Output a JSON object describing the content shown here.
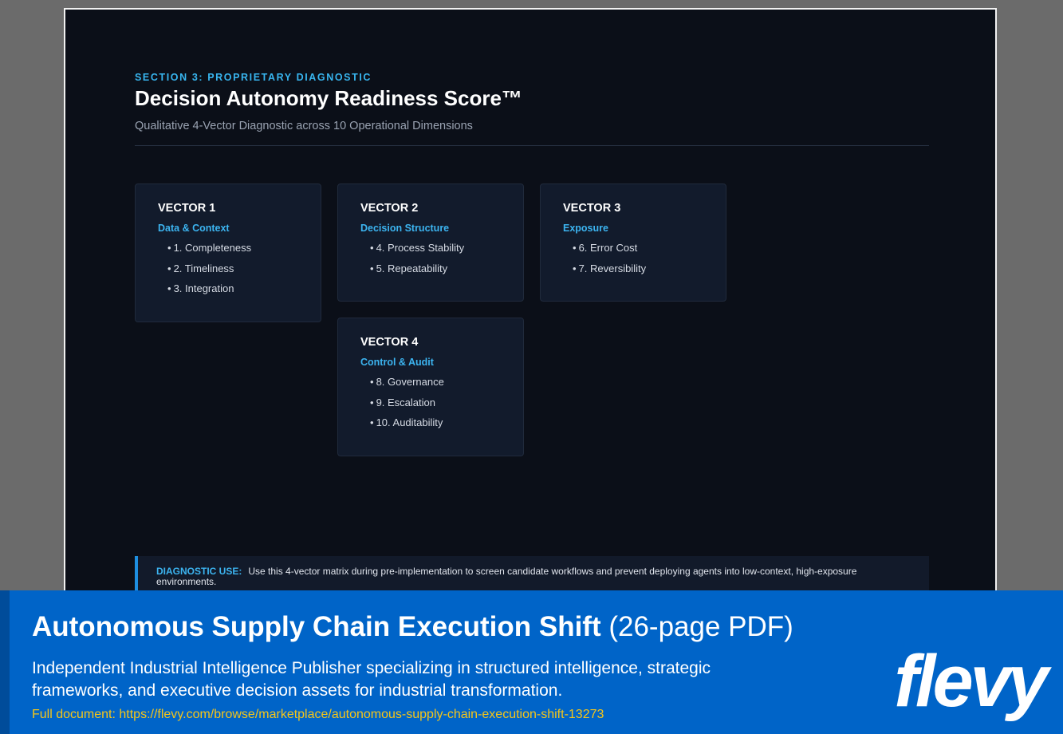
{
  "slide": {
    "eyebrow": "SECTION 3: PROPRIETARY DIAGNOSTIC",
    "title": "Decision Autonomy Readiness Score™",
    "subtitle": "Qualitative 4-Vector Diagnostic across 10 Operational Dimensions",
    "vectors": [
      {
        "title": "VECTOR 1",
        "subtitle": "Data & Context",
        "items": [
          "1. Completeness",
          "2. Timeliness",
          "3. Integration"
        ]
      },
      {
        "title": "VECTOR 2",
        "subtitle": "Decision Structure",
        "items": [
          "4. Process Stability",
          "5. Repeatability"
        ]
      },
      {
        "title": "VECTOR 3",
        "subtitle": "Exposure",
        "items": [
          "6. Error Cost",
          "7. Reversibility"
        ]
      },
      {
        "title": "VECTOR 4",
        "subtitle": "Control & Audit",
        "items": [
          "8. Governance",
          "9. Escalation",
          "10. Auditability"
        ]
      }
    ],
    "note": {
      "label": "DIAGNOSTIC USE:",
      "text": "Use this 4-vector matrix during pre-implementation to screen candidate workflows and prevent deploying agents into low-context, high-exposure environments."
    },
    "bullet": "•"
  },
  "banner": {
    "title_bold": "Autonomous Supply Chain Execution Shift",
    "title_rest": "(26-page PDF)",
    "description": "Independent Industrial Intelligence Publisher specializing in structured intelligence, strategic frameworks, and executive decision assets for industrial transformation.",
    "link": "Full document: https://flevy.com/browse/marketplace/autonomous-supply-chain-execution-shift-13273",
    "logo": "flevy"
  },
  "colors": {
    "accent": "#38b6f0",
    "slide_bg": "#0b0f18",
    "card_bg": "#121b2c",
    "banner_bg": "#0064c8",
    "link": "#f5c518"
  }
}
